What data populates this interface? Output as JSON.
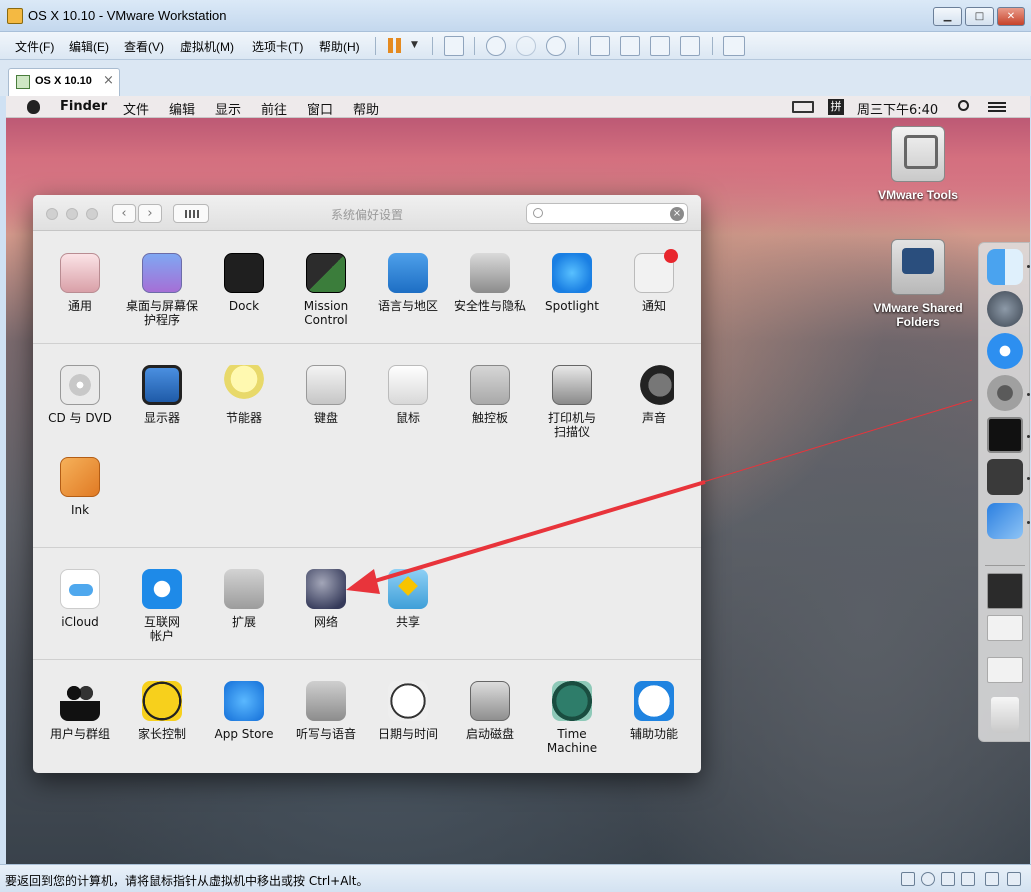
{
  "window": {
    "title": "OS X 10.10 - VMware Workstation",
    "minimize": "▁",
    "maximize": "□",
    "close": "✕"
  },
  "vmware_menu": [
    "文件(F)",
    "编辑(E)",
    "查看(V)",
    "虚拟机(M)",
    "选项卡(T)",
    "帮助(H)"
  ],
  "tab": {
    "label": "OS X 10.10",
    "close": "×"
  },
  "mac_menubar": {
    "app": "Finder",
    "items": [
      "文件",
      "编辑",
      "显示",
      "前往",
      "窗口",
      "帮助"
    ],
    "ime": "拼",
    "clock": "周三下午6:40"
  },
  "desktop_icons": [
    {
      "label": "VMware Tools",
      "icon": "vmware-tools-disk-icon"
    },
    {
      "label": "VMware Shared Folders",
      "icon": "shared-folders-drive-icon"
    }
  ],
  "prefs": {
    "title": "系统偏好设置",
    "back": "‹",
    "forward": "›",
    "search_value": "",
    "search_clear": "×",
    "sections": [
      [
        {
          "label": "通用",
          "icon": "general-icon"
        },
        {
          "label": "桌面与屏幕保护程序",
          "icon": "desktop-screensaver-icon"
        },
        {
          "label": "Dock",
          "icon": "dock-icon"
        },
        {
          "label": "Mission Control",
          "icon": "mission-control-icon"
        },
        {
          "label": "语言与地区",
          "icon": "language-region-icon"
        },
        {
          "label": "安全性与隐私",
          "icon": "security-privacy-icon"
        },
        {
          "label": "Spotlight",
          "icon": "spotlight-icon"
        },
        {
          "label": "通知",
          "icon": "notifications-icon"
        }
      ],
      [
        {
          "label": "CD 与 DVD",
          "icon": "cd-dvd-icon"
        },
        {
          "label": "显示器",
          "icon": "displays-icon"
        },
        {
          "label": "节能器",
          "icon": "energy-saver-icon"
        },
        {
          "label": "键盘",
          "icon": "keyboard-icon"
        },
        {
          "label": "鼠标",
          "icon": "mouse-icon"
        },
        {
          "label": "触控板",
          "icon": "trackpad-icon"
        },
        {
          "label": "打印机与扫描仪",
          "icon": "printers-scanners-icon"
        },
        {
          "label": "声音",
          "icon": "sound-icon"
        },
        {
          "label": "Ink",
          "icon": "ink-icon"
        }
      ],
      [
        {
          "label": "iCloud",
          "icon": "icloud-icon"
        },
        {
          "label": "互联网帐户",
          "icon": "internet-accounts-icon"
        },
        {
          "label": "扩展",
          "icon": "extensions-icon"
        },
        {
          "label": "网络",
          "icon": "network-icon"
        },
        {
          "label": "共享",
          "icon": "sharing-icon"
        }
      ],
      [
        {
          "label": "用户与群组",
          "icon": "users-groups-icon"
        },
        {
          "label": "家长控制",
          "icon": "parental-controls-icon"
        },
        {
          "label": "App Store",
          "icon": "app-store-icon"
        },
        {
          "label": "听写与语音",
          "icon": "dictation-speech-icon"
        },
        {
          "label": "日期与时间",
          "icon": "date-time-icon"
        },
        {
          "label": "启动磁盘",
          "icon": "startup-disk-icon"
        },
        {
          "label": "Time Machine",
          "icon": "time-machine-icon"
        },
        {
          "label": "辅助功能",
          "icon": "accessibility-icon"
        }
      ]
    ]
  },
  "dock": [
    "finder-icon",
    "launchpad-icon",
    "safari-icon",
    "system-preferences-icon",
    "terminal-icon",
    "sublime-text-icon",
    "xcode-icon",
    "document-thumbnail-icon",
    "document-thumbnail-icon",
    "document-thumbnail-icon",
    "trash-icon"
  ],
  "statusbar": {
    "text": "要返回到您的计算机，请将鼠标指针从虚拟机中移出或按 Ctrl+Alt。"
  },
  "colors": {
    "arrow": "#e8343b",
    "menubar_bg": "#f0f0f0",
    "vmware_chrome": "#dbe7f3"
  }
}
